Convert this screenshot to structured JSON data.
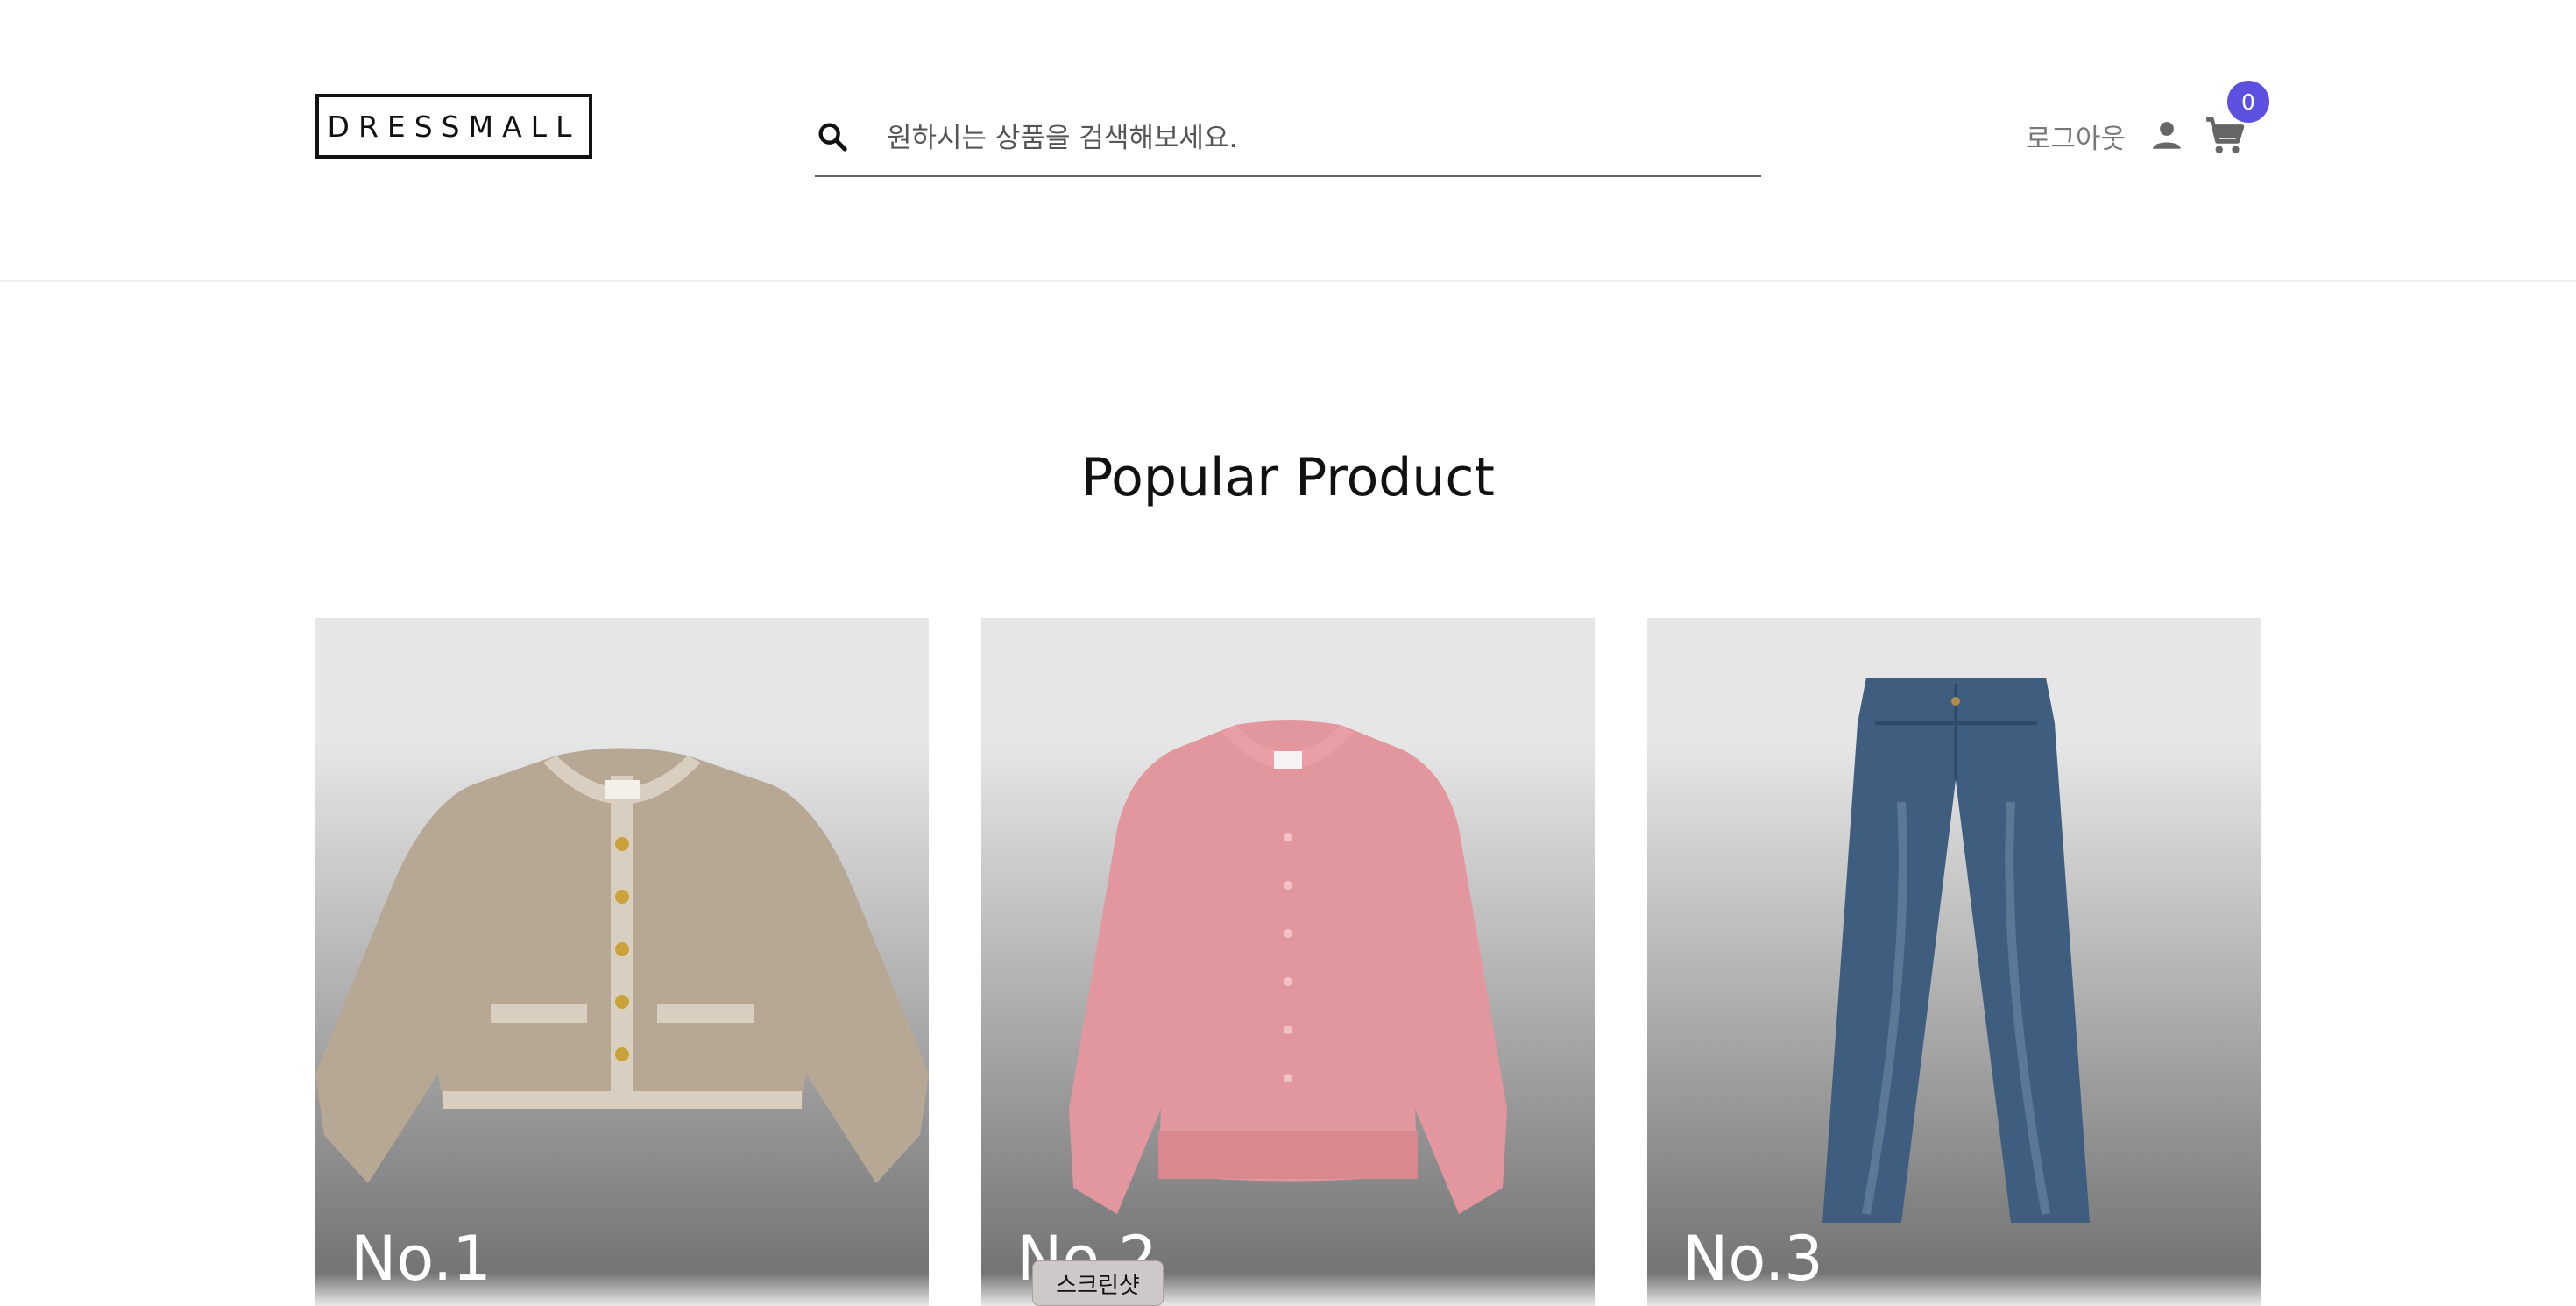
{
  "header": {
    "logo": "DRESSMALL",
    "search": {
      "placeholder": "원하시는 상품을 검색해보세요.",
      "value": ""
    },
    "logout_label": "로그아웃",
    "cart_count": "0",
    "accent_color": "#5b50e0"
  },
  "main": {
    "section_title": "Popular Product",
    "products": [
      {
        "rank": "No.1",
        "icon": "cardigan-beige"
      },
      {
        "rank": "No.2",
        "icon": "cardigan-pink"
      },
      {
        "rank": "No.3",
        "icon": "jeans"
      }
    ]
  },
  "overlay": {
    "screenshot_label": "스크린샷"
  }
}
